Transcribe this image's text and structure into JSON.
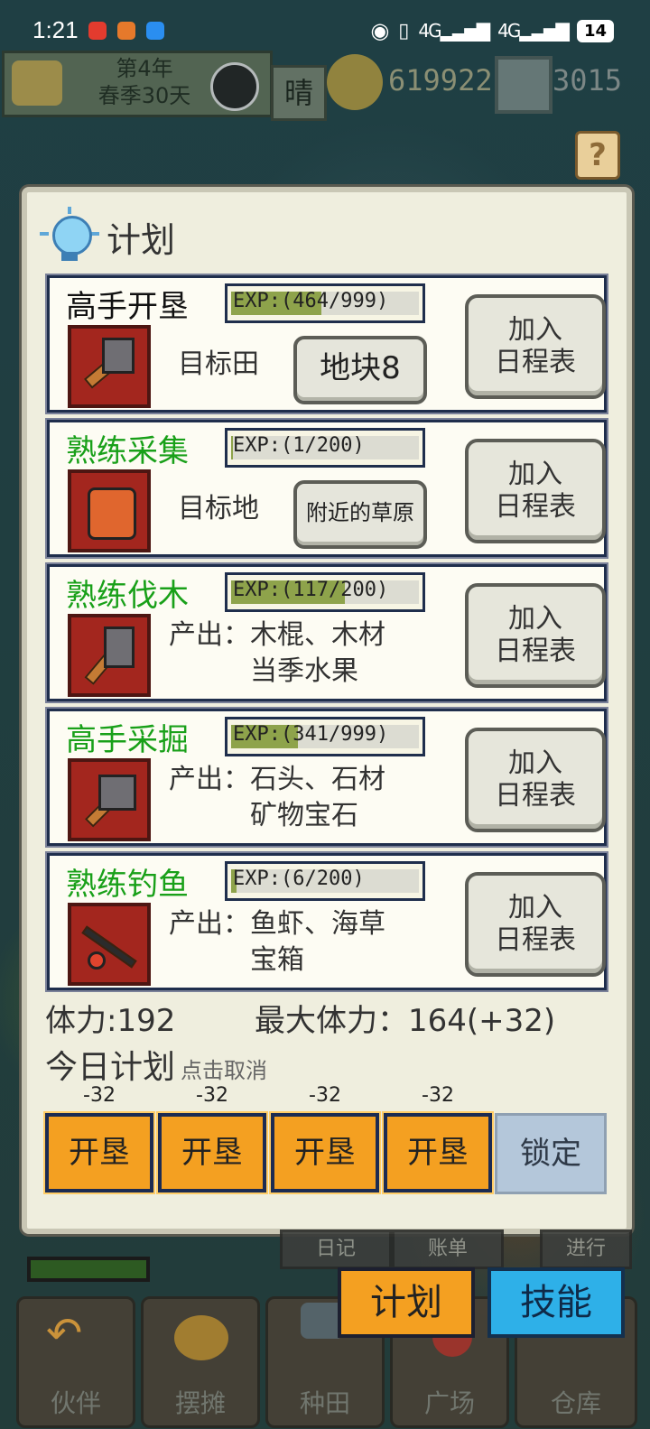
{
  "status_bar": {
    "time": "1:21",
    "battery": "14",
    "signal1": "4G",
    "signal2": "4G"
  },
  "hud": {
    "year": "第4年",
    "season_day": "春季30天",
    "weather": "晴",
    "gold": "619922",
    "gems": "3015",
    "help": "?"
  },
  "panel": {
    "title": "计划",
    "skills": [
      {
        "name": "高手开垦",
        "exp": "EXP:(464/999)",
        "exp_fraction": 0.464,
        "target_label": "目标田",
        "target_button": "地块8",
        "add": [
          "加入",
          "日程表"
        ],
        "tool": "hoe-icon"
      },
      {
        "name": "熟练采集",
        "exp": "EXP:(1/200)",
        "exp_fraction": 0.005,
        "target_label": "目标地",
        "target_button": "附近的草原",
        "add": [
          "加入",
          "日程表"
        ],
        "tool": "backpack-icon"
      },
      {
        "name": "熟练伐木",
        "exp": "EXP:(117/200)",
        "exp_fraction": 0.585,
        "output1": "产出：木棍、木材",
        "output2": "当季水果",
        "add": [
          "加入",
          "日程表"
        ],
        "tool": "axe-icon"
      },
      {
        "name": "高手采掘",
        "exp": "EXP:(341/999)",
        "exp_fraction": 0.341,
        "output1": "产出：石头、石材",
        "output2": "矿物宝石",
        "add": [
          "加入",
          "日程表"
        ],
        "tool": "hammer-icon"
      },
      {
        "name": "熟练钓鱼",
        "exp": "EXP:(6/200)",
        "exp_fraction": 0.03,
        "output1": "产出：鱼虾、海草",
        "output2": "宝箱",
        "add": [
          "加入",
          "日程表"
        ],
        "tool": "fishing-rod-icon"
      }
    ],
    "stamina": "体力:192",
    "max_stamina": "最大体力：164(+32)",
    "today_plan": "今日计划",
    "today_hint": "点击取消",
    "plan_slots": [
      {
        "cost": "-32",
        "label": "开垦"
      },
      {
        "cost": "-32",
        "label": "开垦"
      },
      {
        "cost": "-32",
        "label": "开垦"
      },
      {
        "cost": "-32",
        "label": "开垦"
      }
    ],
    "lock": "锁定"
  },
  "bottom": {
    "mini_tabs": [
      "日记",
      "账单",
      "进行"
    ],
    "plan_button": "计划",
    "skill_button": "技能",
    "nav": [
      "伙伴",
      "摆摊",
      "种田",
      "广场",
      "仓库"
    ]
  }
}
